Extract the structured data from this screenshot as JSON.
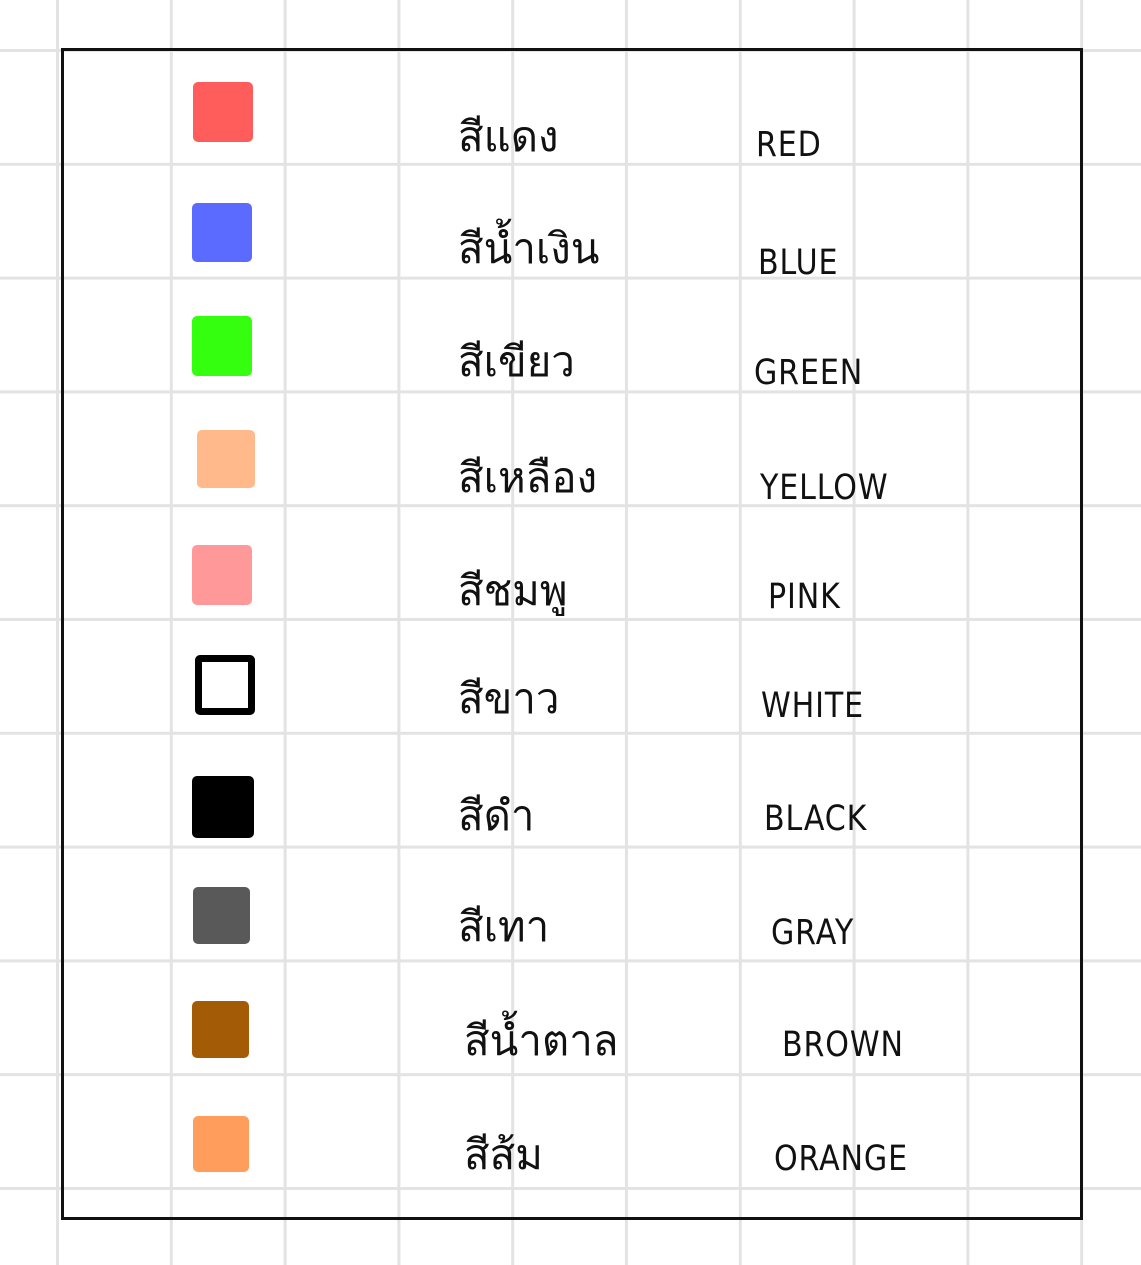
{
  "colors": [
    {
      "thai": "สีแดง",
      "english": "RED",
      "swatch": "#ff5c5c"
    },
    {
      "thai": "สีน้ำเงิน",
      "english": "BLUE",
      "swatch": "#5c6bff"
    },
    {
      "thai": "สีเขียว",
      "english": "GREEN",
      "swatch": "#33ff0f"
    },
    {
      "thai": "สีเหลือง",
      "english": "YELLOW",
      "swatch": "#ffb98a"
    },
    {
      "thai": "สีชมพู",
      "english": "PINK",
      "swatch": "#ff9999"
    },
    {
      "thai": "สีขาว",
      "english": "WHITE",
      "swatch": "#ffffff",
      "swatch_border": "#000000"
    },
    {
      "thai": "สีดำ",
      "english": "BLACK",
      "swatch": "#000000"
    },
    {
      "thai": "สีเทา",
      "english": "GRAY",
      "swatch": "#595959"
    },
    {
      "thai": "สีน้ำตาล",
      "english": "BROWN",
      "swatch": "#a35c05"
    },
    {
      "thai": "สีส้ม",
      "english": "ORANGE",
      "swatch": "#ff9e5c"
    }
  ],
  "theme": {
    "grid_line": "#e3e3e3",
    "frame": "#111111",
    "text": "#111111"
  }
}
